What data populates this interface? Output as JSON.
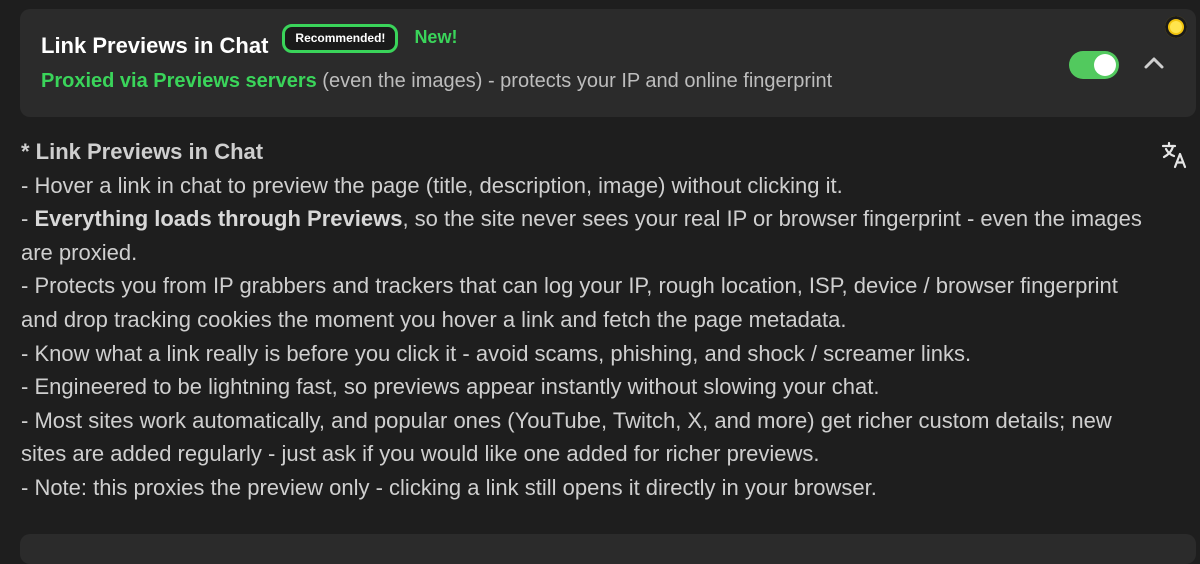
{
  "setting": {
    "title": "Link Previews in Chat",
    "badge_recommended": "Recommended!",
    "badge_new": "New!",
    "subtitle_highlight": "Proxied via Previews servers",
    "subtitle_rest": " (even the images) - protects your IP and online fingerprint",
    "enabled": true
  },
  "description": {
    "heading": "* Link Previews in Chat",
    "line1": "- Hover a link in chat to preview the page (title, description, image) without clicking it.",
    "line2_prefix": "- ",
    "line2_bold": "Everything loads through Previews",
    "line2_rest": ", so the site never sees your real IP or browser fingerprint - even the images are proxied.",
    "line3": "- Protects you from IP grabbers and trackers that can log your IP, rough location, ISP, device / browser fingerprint and drop tracking cookies the moment you hover a link and fetch the page metadata.",
    "line4": "- Know what a link really is before you click it - avoid scams, phishing, and shock / screamer links.",
    "line5": "- Engineered to be lightning fast, so previews appear instantly without slowing your chat.",
    "line6": "- Most sites work automatically, and popular ones (YouTube, Twitch, X, and more) get richer custom details; new sites are added regularly - just ask if you would like one added for richer previews.",
    "line7": "- Note: this proxies the preview only - clicking a link still opens it directly in your browser."
  },
  "icons": {
    "toggle": "toggle-switch-icon",
    "collapse": "chevron-up-icon",
    "status": "status-dot-icon",
    "translate": "translate-icon"
  },
  "colors": {
    "accent_green": "#3ad45a",
    "toggle_green": "#52c95e",
    "status_yellow": "#f2c40f"
  }
}
